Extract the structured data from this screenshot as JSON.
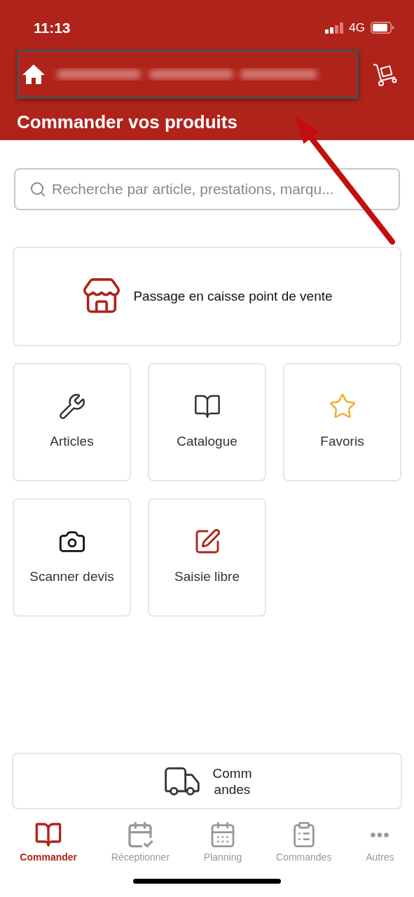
{
  "status_bar": {
    "time": "11:13",
    "network": "4G"
  },
  "header": {
    "title": "Commander vos produits"
  },
  "search": {
    "placeholder": "Recherche par article, prestations, marqu..."
  },
  "checkout_card": {
    "label": "Passage en caisse point de vente"
  },
  "tiles": [
    {
      "label": "Articles"
    },
    {
      "label": "Catalogue"
    },
    {
      "label": "Favoris"
    },
    {
      "label": "Scanner devis"
    },
    {
      "label": "Saisie libre"
    }
  ],
  "orders_button": {
    "label": "Comm\nandes"
  },
  "tab_bar": [
    {
      "label": "Commander",
      "selected": true
    },
    {
      "label": "Réceptionner",
      "selected": false
    },
    {
      "label": "Planning",
      "selected": false
    },
    {
      "label": "Commandes",
      "selected": false
    },
    {
      "label": "Autres",
      "selected": false
    }
  ]
}
